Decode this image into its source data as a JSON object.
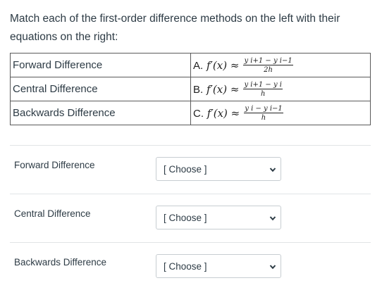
{
  "question": {
    "prompt": "Match each of the first-order difference methods on the left with their equations on the right:"
  },
  "match_table": {
    "rows": [
      {
        "method": "Forward Difference",
        "letter": "A.",
        "lhs": "f′(x) ≈",
        "numerator": "y i+1 − y i−1",
        "denominator": "2h"
      },
      {
        "method": "Central Difference",
        "letter": "B.",
        "lhs": "f′(x) ≈",
        "numerator": "y i+1 − y i",
        "denominator": "h"
      },
      {
        "method": "Backwards Difference",
        "letter": "C.",
        "lhs": "f′(x) ≈",
        "numerator": "y i − y i−1",
        "denominator": "h"
      }
    ]
  },
  "answers": [
    {
      "label": "Forward Difference",
      "selected": "[ Choose ]",
      "icon": "chevron-down-icon"
    },
    {
      "label": "Central Difference",
      "selected": "[ Choose ]",
      "icon": "chevron-down-icon"
    },
    {
      "label": "Backwards Difference",
      "selected": "[ Choose ]",
      "icon": "chevron-down-icon"
    }
  ]
}
